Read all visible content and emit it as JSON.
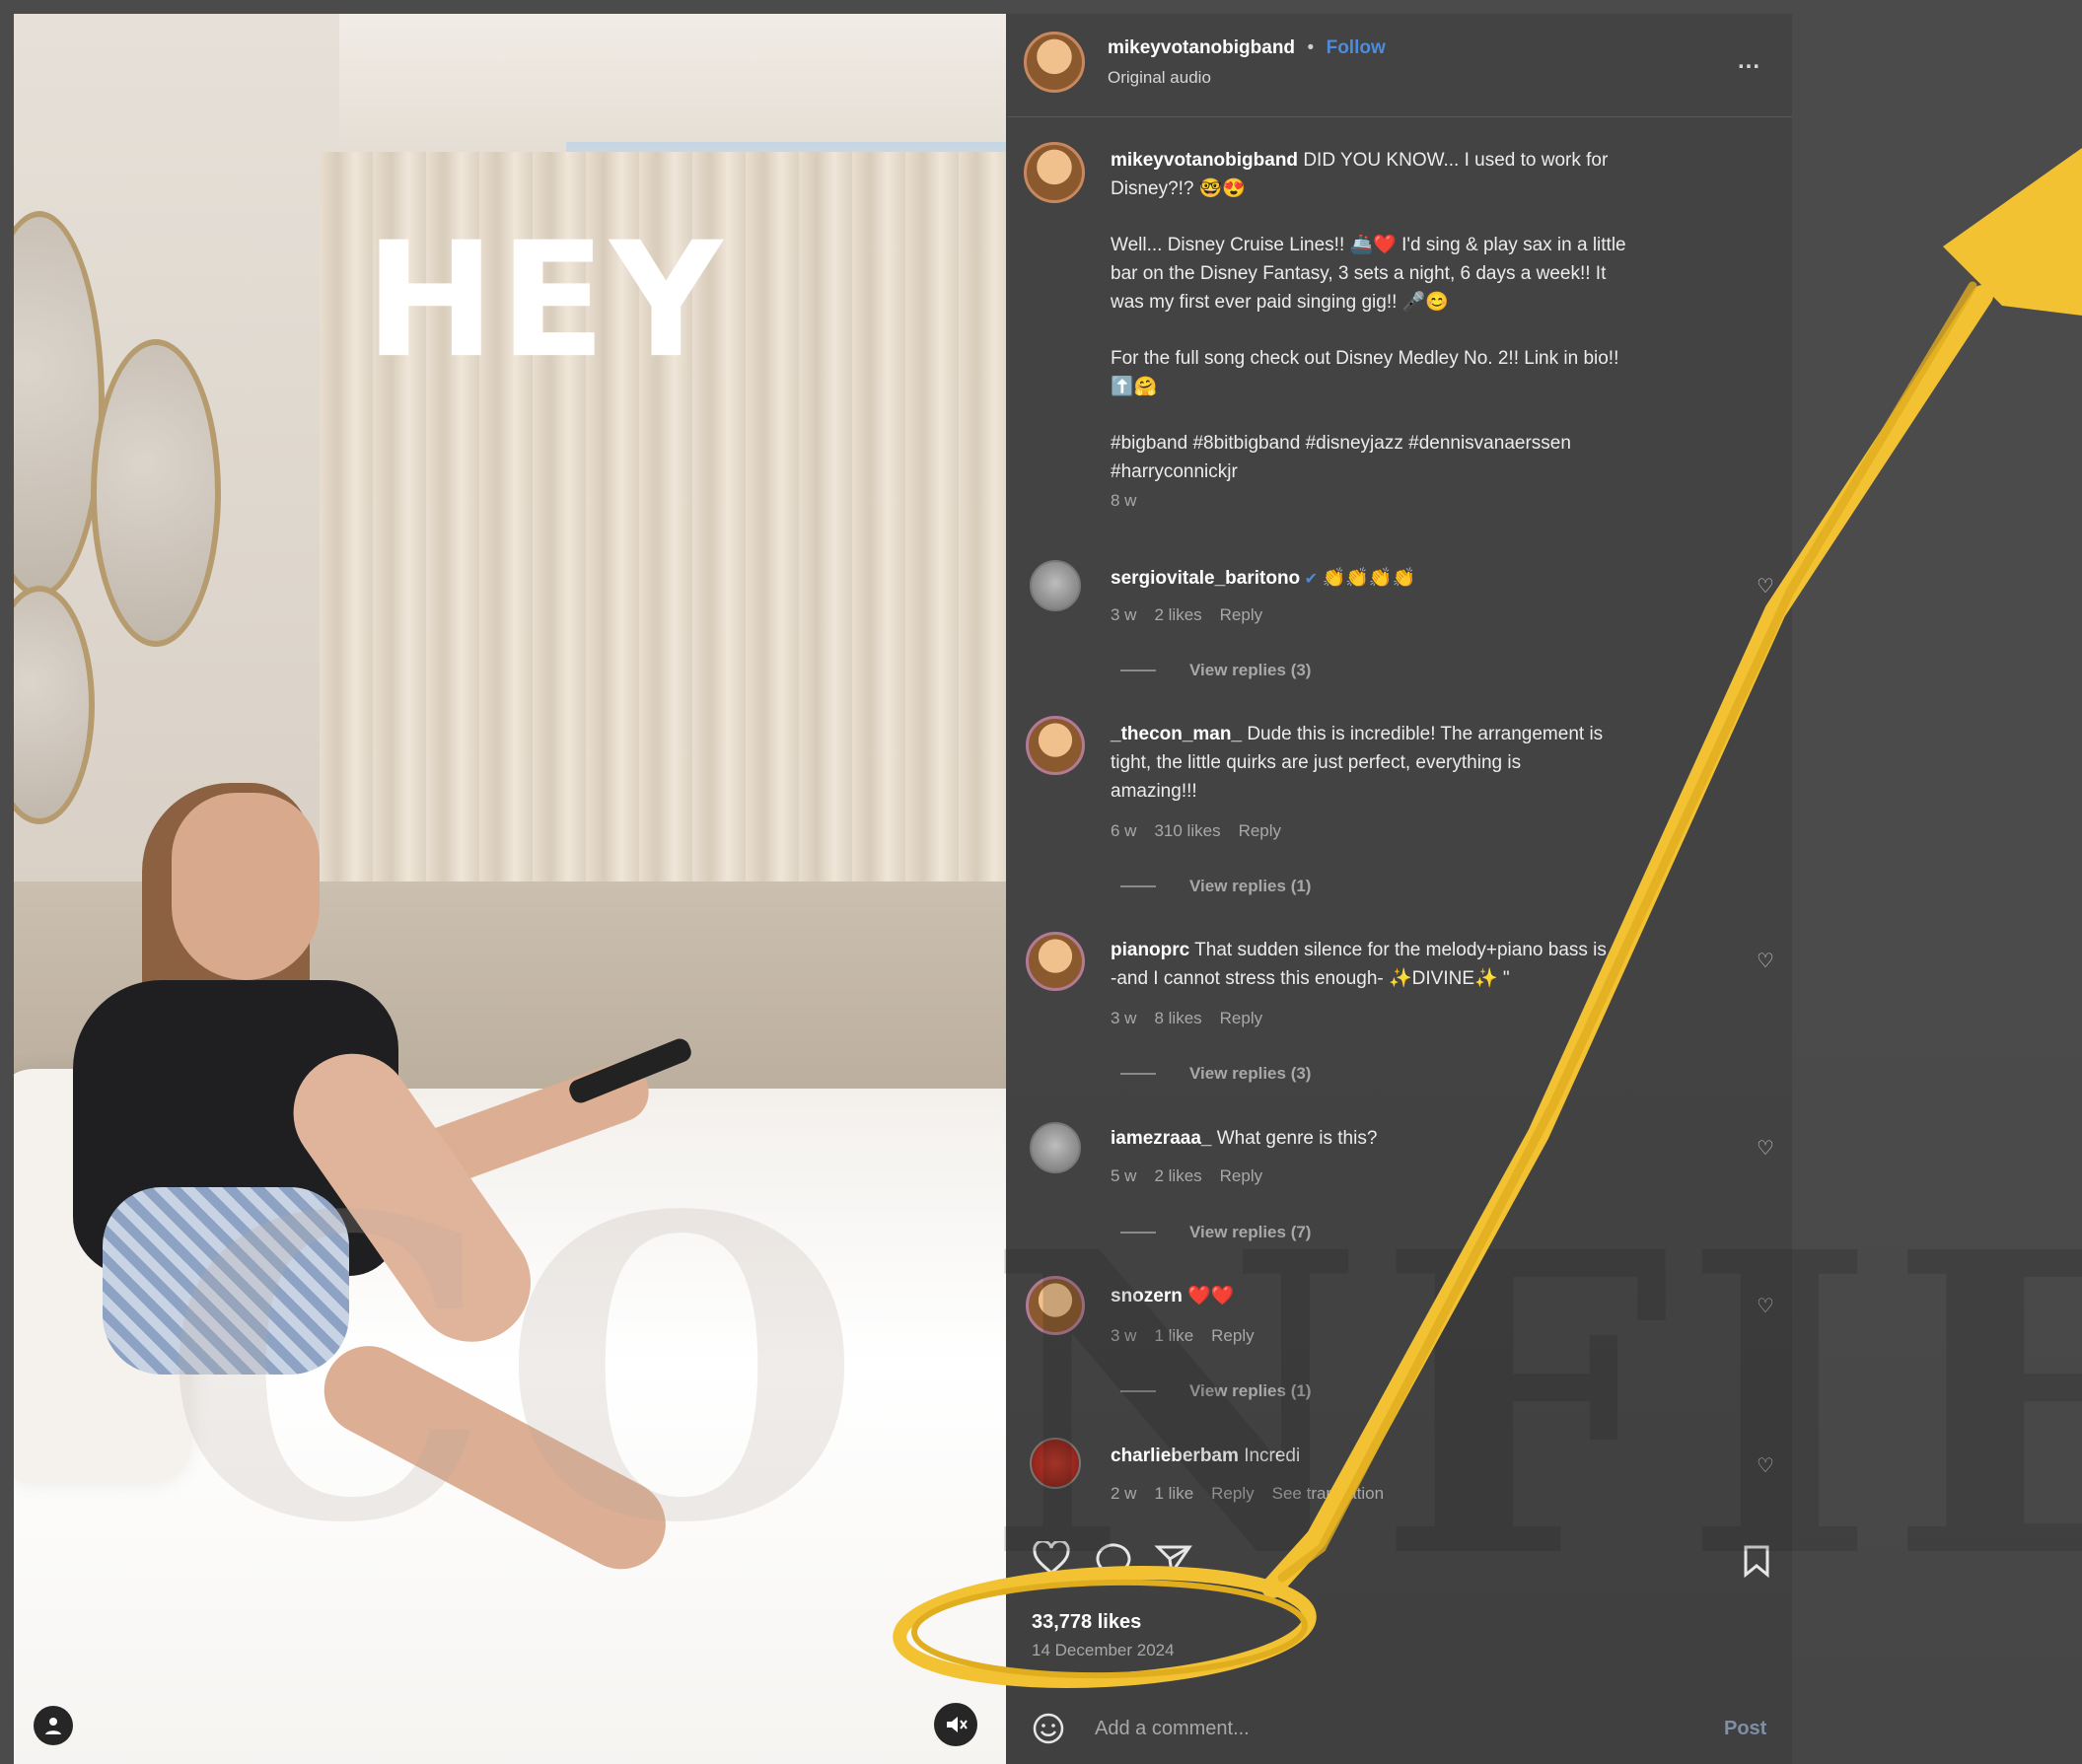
{
  "video": {
    "overlay_text": "HEY",
    "watermark_text": "CO",
    "user_icon": "person-icon",
    "mute_icon": "muted-speaker-icon"
  },
  "header": {
    "username": "mikeyvotanobigband",
    "separator": "•",
    "follow_label": "Follow",
    "audio": "Original audio",
    "more_icon": "ellipsis-icon",
    "more_label": "..."
  },
  "caption": {
    "username": "mikeyvotanobigband",
    "line1": "DID YOU KNOW... I used to work for",
    "line2": "Disney?!? 🤓😍",
    "para2": [
      "Well... Disney Cruise Lines!! 🚢❤️ I'd sing & play sax in a little",
      "bar on the Disney Fantasy, 3 sets a night, 6 days a week!! It",
      "was my first ever paid singing gig!! 🎤😊"
    ],
    "para3": [
      "For the full song check out Disney Medley No. 2!! Link in bio!!",
      "⬆️🤗"
    ],
    "hashtags": [
      "#bigband #8bitbigband #disneyjazz #dennisvanaerssen",
      "#harryconnickjr"
    ],
    "time": "8 w"
  },
  "comments": [
    {
      "username": "sergiovitale_baritono",
      "verified": "✔",
      "text": "👏👏👏👏",
      "time": "3 w",
      "likes": "2 likes",
      "reply": "Reply",
      "view_replies": "View replies (3)"
    },
    {
      "username": "_thecon_man_",
      "text_lines": [
        "Dude this is incredible! The arrangement is",
        "tight, the little quirks are just perfect, everything is",
        "amazing!!!"
      ],
      "time": "6 w",
      "likes": "310 likes",
      "reply": "Reply",
      "view_replies": "View replies (1)"
    },
    {
      "username": "pianoprc",
      "text_lines": [
        "That sudden silence for the melody+piano bass is",
        "-and I cannot stress this enough- ✨DIVINE✨ \""
      ],
      "time": "3 w",
      "likes": "8 likes",
      "reply": "Reply",
      "view_replies": "View replies (3)"
    },
    {
      "username": "iamezraaa_",
      "text": "What genre is this?",
      "time": "5 w",
      "likes": "2 likes",
      "reply": "Reply",
      "view_replies": "View replies (7)"
    },
    {
      "username": "snozern",
      "text": "❤️❤️",
      "time": "3 w",
      "likes": "1 like",
      "reply": "Reply",
      "view_replies": "View replies (1)"
    },
    {
      "username": "charlieberbam",
      "text": "Incredi",
      "time": "2 w",
      "likes": "1 like",
      "reply": "Reply",
      "see_translation": "See translation"
    }
  ],
  "actions": {
    "likes": "33,778 likes",
    "date": "14 December 2024",
    "icons": [
      "heart-icon",
      "comment-icon",
      "share-icon",
      "bookmark-icon"
    ]
  },
  "composer": {
    "emoji_icon": "emoji-icon",
    "placeholder": "Add a comment...",
    "post_label": "Post"
  },
  "colors": {
    "accent_blue": "#4e8bd8",
    "highlight_yellow": "#f3c233",
    "panel_bg": "#434343"
  }
}
